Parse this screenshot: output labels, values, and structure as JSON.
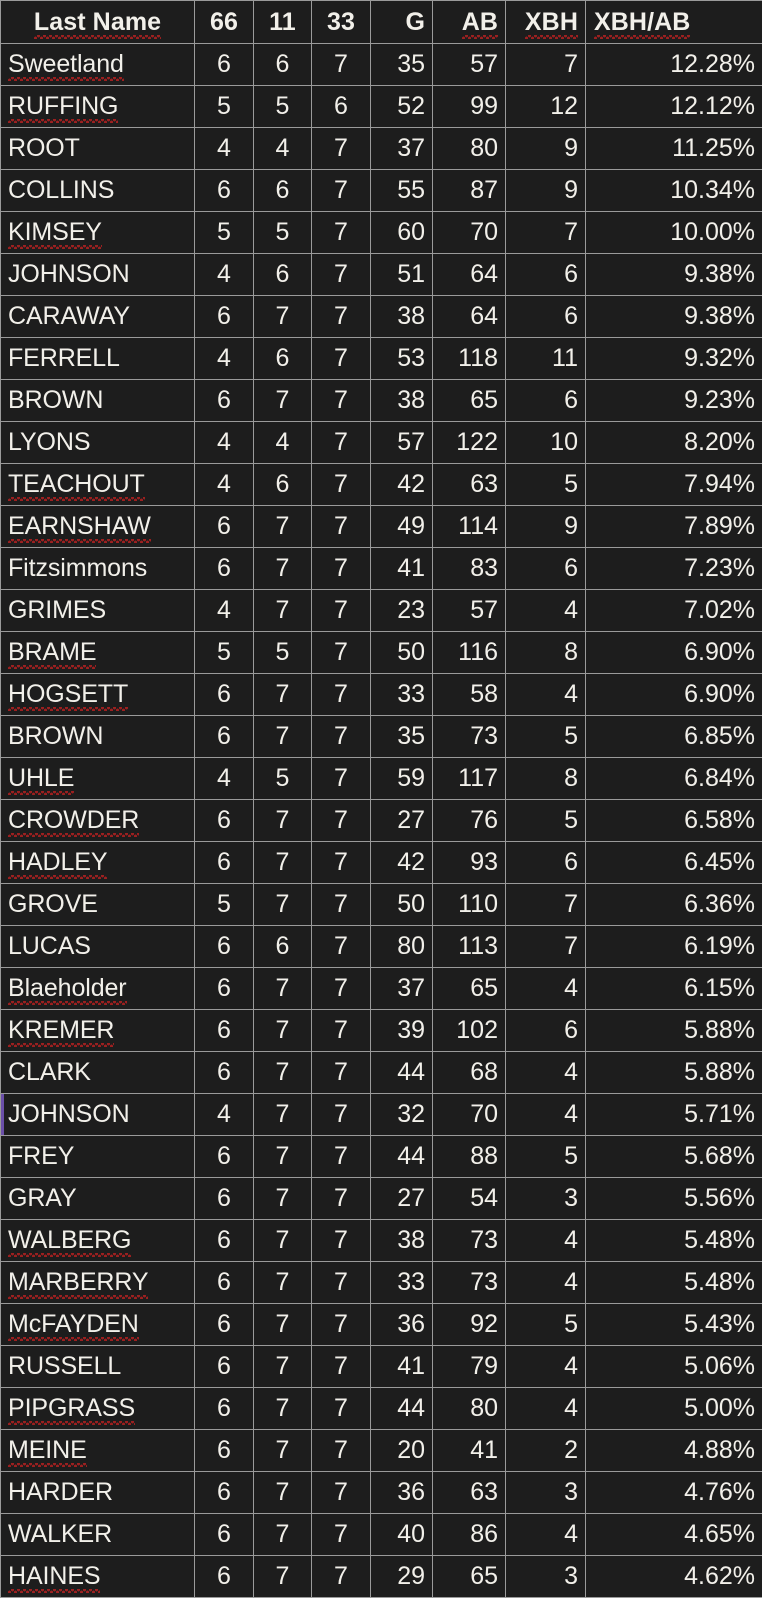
{
  "table": {
    "columns": [
      {
        "key": "last_name",
        "label": "Last Name",
        "align": "center"
      },
      {
        "key": "c66",
        "label": "66",
        "align": "center"
      },
      {
        "key": "c11",
        "label": "11",
        "align": "center"
      },
      {
        "key": "c33",
        "label": "33",
        "align": "center"
      },
      {
        "key": "g",
        "label": "G",
        "align": "right"
      },
      {
        "key": "ab",
        "label": "AB",
        "align": "right"
      },
      {
        "key": "xbh",
        "label": "XBH",
        "align": "right"
      },
      {
        "key": "xbh_ab",
        "label": "XBH/AB",
        "align": "right"
      }
    ],
    "active_row_index": 25,
    "colors": {
      "background": "#1d1d1d",
      "text": "#f2f0ea",
      "gridline": "#9a9a9a",
      "spellcheck_underline": "#9d2020",
      "active_marker": "#6b4fa8"
    },
    "rows": [
      {
        "last_name": "Sweetland",
        "misspelled": true,
        "c66": "6",
        "c11": "6",
        "c33": "7",
        "g": "35",
        "ab": "57",
        "xbh": "7",
        "xbh_ab": "12.28%"
      },
      {
        "last_name": "RUFFING",
        "misspelled": true,
        "c66": "5",
        "c11": "5",
        "c33": "6",
        "g": "52",
        "ab": "99",
        "xbh": "12",
        "xbh_ab": "12.12%"
      },
      {
        "last_name": "ROOT",
        "misspelled": false,
        "c66": "4",
        "c11": "4",
        "c33": "7",
        "g": "37",
        "ab": "80",
        "xbh": "9",
        "xbh_ab": "11.25%"
      },
      {
        "last_name": "COLLINS",
        "misspelled": false,
        "c66": "6",
        "c11": "6",
        "c33": "7",
        "g": "55",
        "ab": "87",
        "xbh": "9",
        "xbh_ab": "10.34%"
      },
      {
        "last_name": "KIMSEY",
        "misspelled": true,
        "c66": "5",
        "c11": "5",
        "c33": "7",
        "g": "60",
        "ab": "70",
        "xbh": "7",
        "xbh_ab": "10.00%"
      },
      {
        "last_name": "JOHNSON",
        "misspelled": false,
        "c66": "4",
        "c11": "6",
        "c33": "7",
        "g": "51",
        "ab": "64",
        "xbh": "6",
        "xbh_ab": "9.38%"
      },
      {
        "last_name": "CARAWAY",
        "misspelled": false,
        "c66": "6",
        "c11": "7",
        "c33": "7",
        "g": "38",
        "ab": "64",
        "xbh": "6",
        "xbh_ab": "9.38%"
      },
      {
        "last_name": "FERRELL",
        "misspelled": false,
        "c66": "4",
        "c11": "6",
        "c33": "7",
        "g": "53",
        "ab": "118",
        "xbh": "11",
        "xbh_ab": "9.32%"
      },
      {
        "last_name": "BROWN",
        "misspelled": false,
        "c66": "6",
        "c11": "7",
        "c33": "7",
        "g": "38",
        "ab": "65",
        "xbh": "6",
        "xbh_ab": "9.23%"
      },
      {
        "last_name": "LYONS",
        "misspelled": false,
        "c66": "4",
        "c11": "4",
        "c33": "7",
        "g": "57",
        "ab": "122",
        "xbh": "10",
        "xbh_ab": "8.20%"
      },
      {
        "last_name": "TEACHOUT",
        "misspelled": true,
        "c66": "4",
        "c11": "6",
        "c33": "7",
        "g": "42",
        "ab": "63",
        "xbh": "5",
        "xbh_ab": "7.94%"
      },
      {
        "last_name": "EARNSHAW",
        "misspelled": true,
        "c66": "6",
        "c11": "7",
        "c33": "7",
        "g": "49",
        "ab": "114",
        "xbh": "9",
        "xbh_ab": "7.89%"
      },
      {
        "last_name": "Fitzsimmons",
        "misspelled": false,
        "c66": "6",
        "c11": "7",
        "c33": "7",
        "g": "41",
        "ab": "83",
        "xbh": "6",
        "xbh_ab": "7.23%"
      },
      {
        "last_name": "GRIMES",
        "misspelled": false,
        "c66": "4",
        "c11": "7",
        "c33": "7",
        "g": "23",
        "ab": "57",
        "xbh": "4",
        "xbh_ab": "7.02%"
      },
      {
        "last_name": "BRAME",
        "misspelled": true,
        "c66": "5",
        "c11": "5",
        "c33": "7",
        "g": "50",
        "ab": "116",
        "xbh": "8",
        "xbh_ab": "6.90%"
      },
      {
        "last_name": "HOGSETT",
        "misspelled": true,
        "c66": "6",
        "c11": "7",
        "c33": "7",
        "g": "33",
        "ab": "58",
        "xbh": "4",
        "xbh_ab": "6.90%"
      },
      {
        "last_name": "BROWN",
        "misspelled": false,
        "c66": "6",
        "c11": "7",
        "c33": "7",
        "g": "35",
        "ab": "73",
        "xbh": "5",
        "xbh_ab": "6.85%"
      },
      {
        "last_name": "UHLE",
        "misspelled": true,
        "c66": "4",
        "c11": "5",
        "c33": "7",
        "g": "59",
        "ab": "117",
        "xbh": "8",
        "xbh_ab": "6.84%"
      },
      {
        "last_name": "CROWDER",
        "misspelled": true,
        "c66": "6",
        "c11": "7",
        "c33": "7",
        "g": "27",
        "ab": "76",
        "xbh": "5",
        "xbh_ab": "6.58%"
      },
      {
        "last_name": "HADLEY",
        "misspelled": true,
        "c66": "6",
        "c11": "7",
        "c33": "7",
        "g": "42",
        "ab": "93",
        "xbh": "6",
        "xbh_ab": "6.45%"
      },
      {
        "last_name": "GROVE",
        "misspelled": false,
        "c66": "5",
        "c11": "7",
        "c33": "7",
        "g": "50",
        "ab": "110",
        "xbh": "7",
        "xbh_ab": "6.36%"
      },
      {
        "last_name": "LUCAS",
        "misspelled": false,
        "c66": "6",
        "c11": "6",
        "c33": "7",
        "g": "80",
        "ab": "113",
        "xbh": "7",
        "xbh_ab": "6.19%"
      },
      {
        "last_name": "Blaeholder",
        "misspelled": true,
        "c66": "6",
        "c11": "7",
        "c33": "7",
        "g": "37",
        "ab": "65",
        "xbh": "4",
        "xbh_ab": "6.15%"
      },
      {
        "last_name": "KREMER",
        "misspelled": true,
        "c66": "6",
        "c11": "7",
        "c33": "7",
        "g": "39",
        "ab": "102",
        "xbh": "6",
        "xbh_ab": "5.88%"
      },
      {
        "last_name": "CLARK",
        "misspelled": false,
        "c66": "6",
        "c11": "7",
        "c33": "7",
        "g": "44",
        "ab": "68",
        "xbh": "4",
        "xbh_ab": "5.88%"
      },
      {
        "last_name": "JOHNSON",
        "misspelled": false,
        "c66": "4",
        "c11": "7",
        "c33": "7",
        "g": "32",
        "ab": "70",
        "xbh": "4",
        "xbh_ab": "5.71%"
      },
      {
        "last_name": "FREY",
        "misspelled": false,
        "c66": "6",
        "c11": "7",
        "c33": "7",
        "g": "44",
        "ab": "88",
        "xbh": "5",
        "xbh_ab": "5.68%"
      },
      {
        "last_name": "GRAY",
        "misspelled": false,
        "c66": "6",
        "c11": "7",
        "c33": "7",
        "g": "27",
        "ab": "54",
        "xbh": "3",
        "xbh_ab": "5.56%"
      },
      {
        "last_name": "WALBERG",
        "misspelled": true,
        "c66": "6",
        "c11": "7",
        "c33": "7",
        "g": "38",
        "ab": "73",
        "xbh": "4",
        "xbh_ab": "5.48%"
      },
      {
        "last_name": "MARBERRY",
        "misspelled": true,
        "c66": "6",
        "c11": "7",
        "c33": "7",
        "g": "33",
        "ab": "73",
        "xbh": "4",
        "xbh_ab": "5.48%"
      },
      {
        "last_name": "McFAYDEN",
        "misspelled": true,
        "c66": "6",
        "c11": "7",
        "c33": "7",
        "g": "36",
        "ab": "92",
        "xbh": "5",
        "xbh_ab": "5.43%"
      },
      {
        "last_name": "RUSSELL",
        "misspelled": false,
        "c66": "6",
        "c11": "7",
        "c33": "7",
        "g": "41",
        "ab": "79",
        "xbh": "4",
        "xbh_ab": "5.06%"
      },
      {
        "last_name": "PIPGRASS",
        "misspelled": true,
        "c66": "6",
        "c11": "7",
        "c33": "7",
        "g": "44",
        "ab": "80",
        "xbh": "4",
        "xbh_ab": "5.00%"
      },
      {
        "last_name": "MEINE",
        "misspelled": true,
        "c66": "6",
        "c11": "7",
        "c33": "7",
        "g": "20",
        "ab": "41",
        "xbh": "2",
        "xbh_ab": "4.88%"
      },
      {
        "last_name": "HARDER",
        "misspelled": false,
        "c66": "6",
        "c11": "7",
        "c33": "7",
        "g": "36",
        "ab": "63",
        "xbh": "3",
        "xbh_ab": "4.76%"
      },
      {
        "last_name": "WALKER",
        "misspelled": false,
        "c66": "6",
        "c11": "7",
        "c33": "7",
        "g": "40",
        "ab": "86",
        "xbh": "4",
        "xbh_ab": "4.65%"
      },
      {
        "last_name": "HAINES",
        "misspelled": true,
        "c66": "6",
        "c11": "7",
        "c33": "7",
        "g": "29",
        "ab": "65",
        "xbh": "3",
        "xbh_ab": "4.62%"
      }
    ]
  }
}
